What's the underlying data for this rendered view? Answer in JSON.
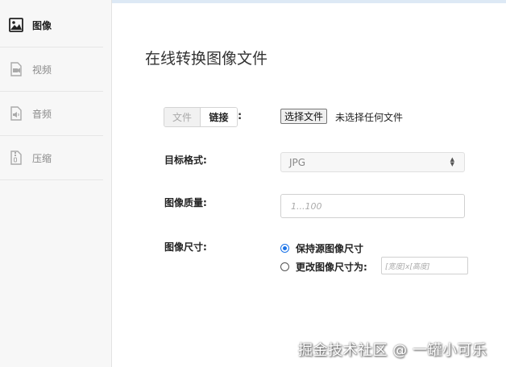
{
  "sidebar": {
    "items": [
      {
        "label": "图像",
        "icon": "image-icon",
        "active": true
      },
      {
        "label": "视频",
        "icon": "video-icon",
        "active": false
      },
      {
        "label": "音频",
        "icon": "audio-icon",
        "active": false
      },
      {
        "label": "压缩",
        "icon": "compress-icon",
        "active": false
      }
    ]
  },
  "main": {
    "title": "在线转换图像文件",
    "source": {
      "tabs": [
        "文件",
        "链接"
      ],
      "colon": ":",
      "file_button": "选择文件",
      "file_status": "未选择任何文件"
    },
    "format": {
      "label": "目标格式:",
      "selected": "JPG"
    },
    "quality": {
      "label": "图像质量:",
      "placeholder": "1...100"
    },
    "size": {
      "label": "图像尺寸:",
      "options": [
        "保持源图像尺寸",
        "更改图像尺寸为:"
      ],
      "selected_index": 0,
      "placeholder": "[宽度]x[高度]"
    }
  },
  "watermark": "掘金技术社区 @ 一罐小可乐",
  "colors": {
    "accent": "#1a73e8",
    "sidebar_bg": "#f7f7f7"
  }
}
